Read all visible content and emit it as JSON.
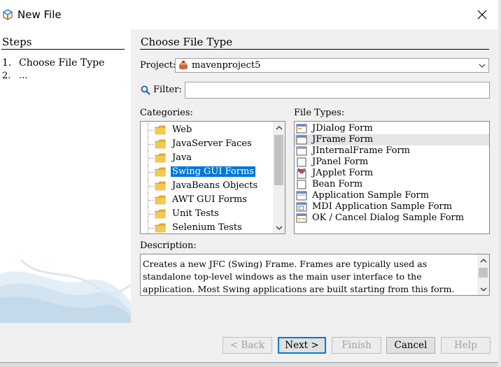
{
  "dialog": {
    "title": "New File",
    "close_icon": "close-icon"
  },
  "steps": {
    "heading": "Steps",
    "items": [
      {
        "num": "1.",
        "label": "Choose File Type"
      },
      {
        "num": "2.",
        "label": "..."
      }
    ]
  },
  "main": {
    "heading": "Choose File Type",
    "project_label": "Project:",
    "project_value": "mavenproject5",
    "filter_label": "Filter:",
    "filter_value": "",
    "categories_label": "Categories:",
    "categories": [
      {
        "label": "Web",
        "selected": false
      },
      {
        "label": "JavaServer Faces",
        "selected": false
      },
      {
        "label": "Java",
        "selected": false
      },
      {
        "label": "Swing GUI Forms",
        "selected": true
      },
      {
        "label": "JavaBeans Objects",
        "selected": false
      },
      {
        "label": "AWT GUI Forms",
        "selected": false
      },
      {
        "label": "Unit Tests",
        "selected": false
      },
      {
        "label": "Selenium Tests",
        "selected": false
      }
    ],
    "file_types_label": "File Types:",
    "file_types": [
      {
        "label": "JDialog Form",
        "icon": "dialog-form-icon",
        "selected": false
      },
      {
        "label": "JFrame Form",
        "icon": "frame-form-icon",
        "selected": true
      },
      {
        "label": "JInternalFrame Form",
        "icon": "internal-frame-icon",
        "selected": false
      },
      {
        "label": "JPanel Form",
        "icon": "panel-form-icon",
        "selected": false
      },
      {
        "label": "JApplet Form",
        "icon": "applet-form-icon",
        "selected": false
      },
      {
        "label": "Bean Form",
        "icon": "bean-form-icon",
        "selected": false
      },
      {
        "label": "Application Sample Form",
        "icon": "application-sample-icon",
        "selected": false
      },
      {
        "label": "MDI Application Sample Form",
        "icon": "mdi-application-icon",
        "selected": false
      },
      {
        "label": "OK / Cancel Dialog Sample Form",
        "icon": "ok-cancel-dialog-icon",
        "selected": false
      }
    ],
    "description_label": "Description:",
    "description": "Creates a new JFC (Swing) Frame. Frames are typically used as standalone top-level windows as the main user interface to the application. Most Swing applications are built starting from this form."
  },
  "buttons": {
    "back": "< Back",
    "next": "Next >",
    "finish": "Finish",
    "cancel": "Cancel",
    "help": "Help"
  },
  "colors": {
    "selection": "#0078d7",
    "folder": "#e8b030",
    "window_bg": "#f0f0f0"
  }
}
